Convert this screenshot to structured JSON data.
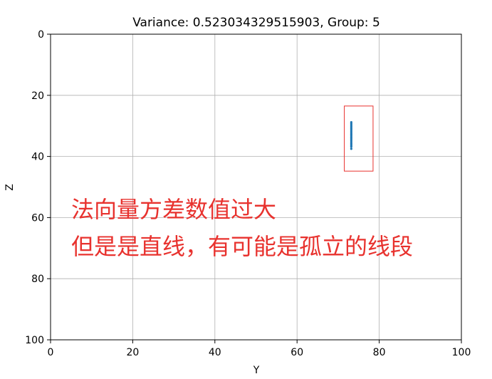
{
  "chart_data": {
    "type": "scatter",
    "title": "Variance: 0.523034329515903, Group: 5",
    "xlabel": "Y",
    "ylabel": "Z",
    "xlim": [
      0,
      100
    ],
    "ylim": [
      100,
      0
    ],
    "y_axis_inverted": true,
    "grid": true,
    "xticks": [
      "0",
      "20",
      "40",
      "60",
      "80",
      "100"
    ],
    "yticks": [
      "0",
      "20",
      "40",
      "60",
      "80",
      "100"
    ],
    "points": {
      "color": "#1f77b4",
      "x": [
        73.2,
        73.2,
        73.2,
        73.2,
        73.2,
        73.2,
        73.2,
        73.2,
        73.2,
        73.2,
        73.2,
        73.2,
        73.2,
        73.2,
        73.2,
        73.2,
        73.2,
        73.2
      ],
      "y": [
        28.8,
        29.3,
        29.8,
        30.3,
        30.8,
        31.3,
        31.8,
        32.3,
        32.8,
        33.3,
        33.8,
        34.3,
        34.8,
        35.3,
        35.8,
        36.3,
        36.8,
        37.5
      ]
    },
    "highlight_box": {
      "color": "#e8322e",
      "x_range": [
        71.5,
        78.5
      ],
      "y_range": [
        23.5,
        44.8
      ]
    }
  },
  "annotation": {
    "line1": "法向量方差数值过大",
    "line2": "但是是直线，有可能是孤立的线段",
    "color": "#e8322e"
  }
}
